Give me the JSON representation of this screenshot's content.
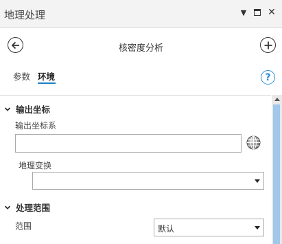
{
  "window": {
    "title": "地理处理"
  },
  "tool": {
    "title": "核密度分析"
  },
  "tabs": [
    {
      "label": "参数"
    },
    {
      "label": "环境"
    }
  ],
  "sections": {
    "output_coords": {
      "title": "输出坐标",
      "output_cs_label": "输出坐标系",
      "output_cs_value": "",
      "geo_transform_label": "地理变换",
      "geo_transform_value": ""
    },
    "processing_extent": {
      "title": "处理范围",
      "extent_label": "范围",
      "extent_value": "默认"
    }
  },
  "help": {
    "glyph": "?"
  },
  "colors": {
    "accent": "#1a80c7",
    "scroll_thumb": "#9fc8ea"
  }
}
